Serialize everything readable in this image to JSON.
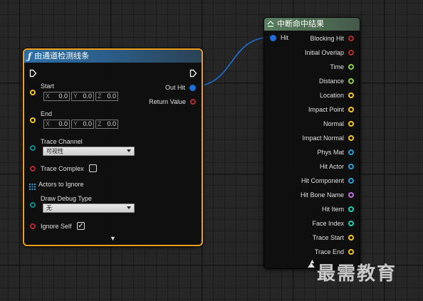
{
  "trace_node": {
    "title": "由通道检测线条",
    "title_icon": "function-icon",
    "inputs": {
      "start_label": "Start",
      "end_label": "End",
      "axis_x": "X",
      "axis_y": "Y",
      "axis_z": "Z",
      "start": {
        "x": "0.0",
        "y": "0.0",
        "z": "0.0"
      },
      "end": {
        "x": "0.0",
        "y": "0.0",
        "z": "0.0"
      },
      "trace_channel_label": "Trace Channel",
      "trace_channel_value": "可视性",
      "trace_complex_label": "Trace Complex",
      "trace_complex_checked": false,
      "actors_to_ignore_label": "Actors to Ignore",
      "draw_debug_type_label": "Draw Debug Type",
      "draw_debug_type_value": "无",
      "ignore_self_label": "Ignore Self",
      "ignore_self_checked": true,
      "ignore_self_mark": "✓"
    },
    "outputs": {
      "out_hit_label": "Out Hit",
      "return_value_label": "Return Value"
    },
    "expand_glyph": "▼"
  },
  "break_node": {
    "title": "中断命中结果",
    "title_icon": "break-struct-icon",
    "input_label": "Hit",
    "outputs": [
      {
        "label": "Blocking Hit",
        "color": "#b52a2a"
      },
      {
        "label": "Initial Overlap",
        "color": "#b52a2a"
      },
      {
        "label": "Time",
        "color": "#8ed24a"
      },
      {
        "label": "Distance",
        "color": "#8ed24a"
      },
      {
        "label": "Location",
        "color": "#f3c521"
      },
      {
        "label": "Impact Point",
        "color": "#f3c521"
      },
      {
        "label": "Normal",
        "color": "#f3c521"
      },
      {
        "label": "Impact Normal",
        "color": "#f3c521"
      },
      {
        "label": "Phys Mat",
        "color": "#2b9fd6"
      },
      {
        "label": "Hit Actor",
        "color": "#2b9fd6"
      },
      {
        "label": "Hit Component",
        "color": "#2b9fd6"
      },
      {
        "label": "Hit Bone Name",
        "color": "#c070e8"
      },
      {
        "label": "Hit Item",
        "color": "#1fd3b0"
      },
      {
        "label": "Face Index",
        "color": "#1fd3b0"
      },
      {
        "label": "Trace Start",
        "color": "#f3c521"
      },
      {
        "label": "Trace End",
        "color": "#f3c521"
      }
    ],
    "expand_glyph": "▲"
  },
  "pin_colors": {
    "exec": "#e6e6e6",
    "vector": "#f3c521",
    "struct": "#1e70d8",
    "bool": "#b52a2a",
    "enum": "#0d8b8b",
    "array": "#2b9fd6"
  },
  "accent": {
    "selection_border": "#f2a11b",
    "wire": "#1e70d8"
  },
  "watermark": "最需教育"
}
